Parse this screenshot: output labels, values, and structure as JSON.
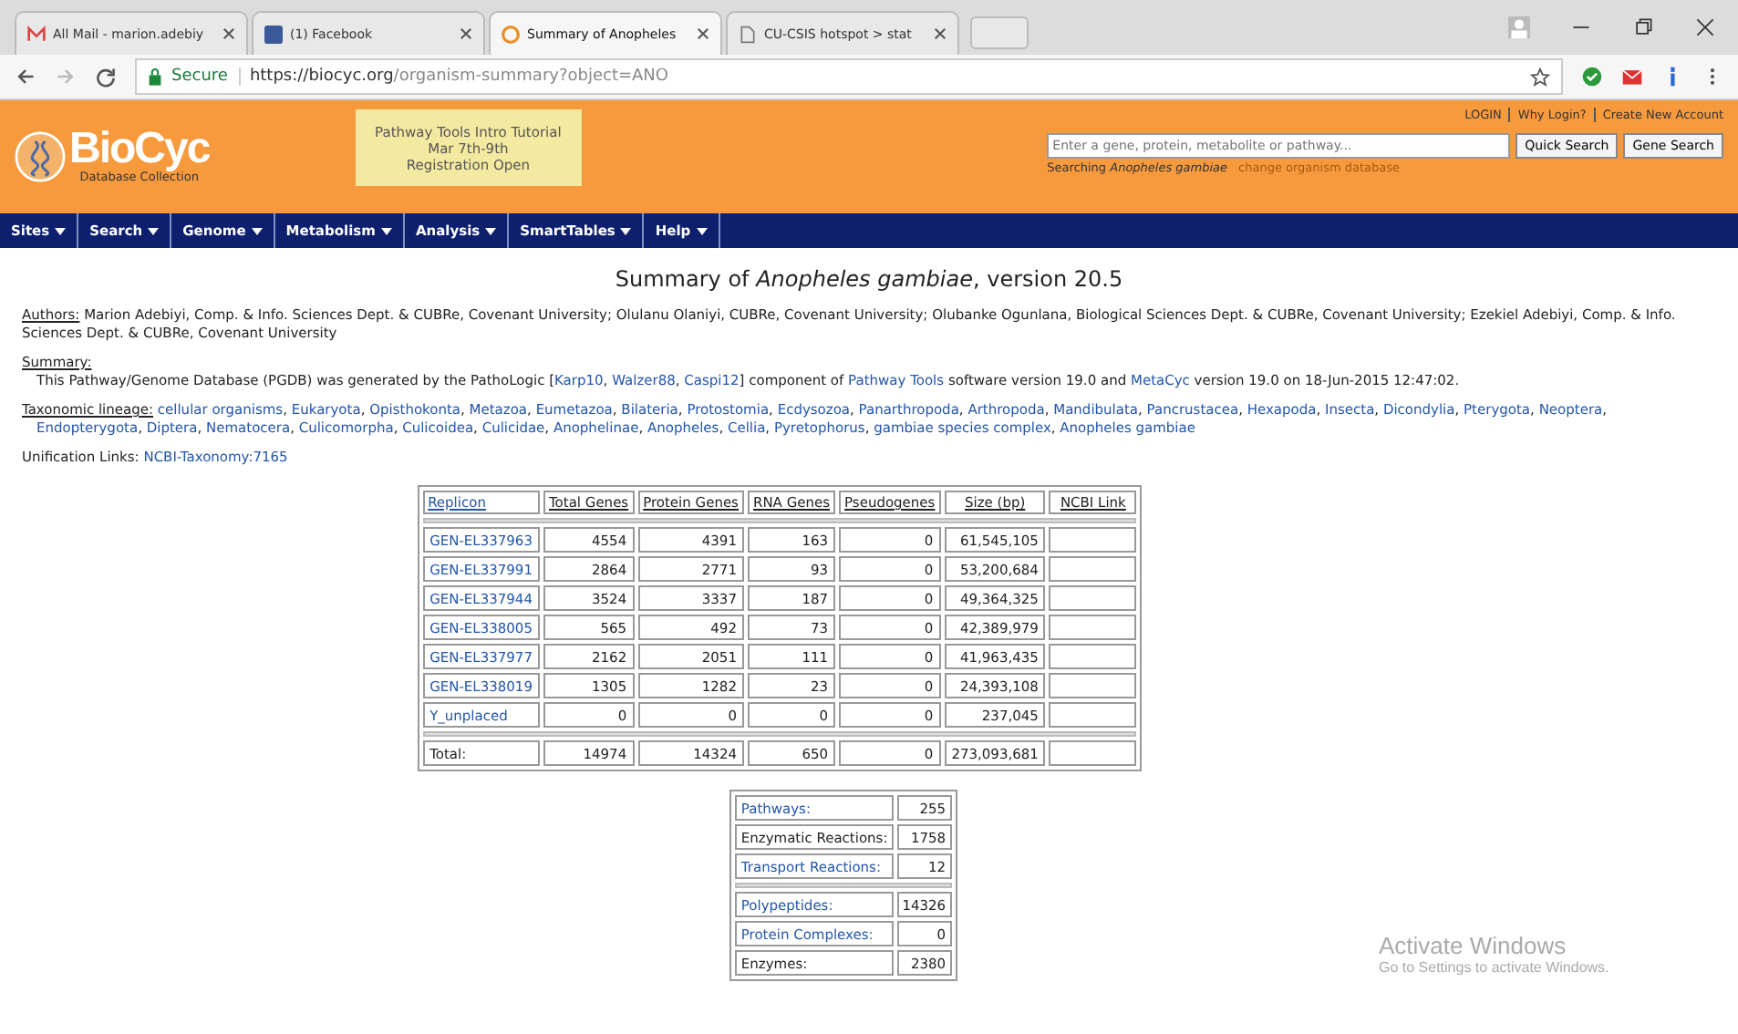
{
  "browser": {
    "tabs": [
      {
        "title": "All Mail - marion.adebiy",
        "kind": "mail",
        "selected": false
      },
      {
        "title": "(1) Facebook",
        "kind": "facebook",
        "selected": false
      },
      {
        "title": "Summary of Anopheles",
        "kind": "loading",
        "selected": true
      },
      {
        "title": "CU-CSIS hotspot > stat",
        "kind": "page",
        "selected": false
      }
    ],
    "secure_label": "Secure",
    "url_host": "https://biocyc.org",
    "url_path": "/organism-summary?object=ANO"
  },
  "header": {
    "logo": "BioCyc",
    "logo_sub": "Database Collection",
    "announcement": [
      "Pathway Tools Intro Tutorial",
      "Mar 7th-9th",
      "Registration Open"
    ],
    "account_links": [
      "LOGIN",
      "Why Login?",
      "Create New Account"
    ],
    "search": {
      "placeholder": "Enter a gene, protein, metabolite or pathway...",
      "buttons": [
        "Quick Search",
        "Gene Search"
      ]
    },
    "searching": "Searching *Anopheles gambiae*",
    "change_link": "change organism database"
  },
  "nav": [
    "Sites",
    "Search",
    "Genome",
    "Metabolism",
    "Analysis",
    "SmartTables",
    "Help"
  ],
  "page": {
    "title": "Summary of *Anopheles gambiae*, version 20.5",
    "authors_label": "Authors:",
    "authors": "Marion Adebiyi, Comp. & Info. Sciences Dept. & CUBRe, Covenant University; Olulanu Olaniyi, CUBRe, Covenant University; Olubanke Ogunlana, Biological Sciences Dept. & CUBRe, Covenant University; Ezekiel Adebiyi, Comp. & Info. Sciences Dept. & CUBRe, Covenant University",
    "summary_label": "Summary:",
    "summary": {
      "before": "This Pathway/Genome Database (PGDB) was generated by the PathoLogic [",
      "references": [
        "Karp10",
        "Walzer88",
        "Caspi12"
      ],
      "reference_separator": ",",
      "middle": "] component of",
      "tool_link": "Pathway Tools",
      "after_tool": "software version 19.0 and",
      "db_link": "MetaCyc",
      "end": "version 19.0 on 18-Jun-2015 12:47:02."
    },
    "lineage_label": "Taxonomic lineage:",
    "lineage_separator": ",",
    "lineage": [
      "cellular organisms",
      "Eukaryota",
      "Opisthokonta",
      "Metazoa",
      "Eumetazoa",
      "Bilateria",
      "Protostomia",
      "Ecdysozoa",
      "Panarthropoda",
      "Arthropoda",
      "Mandibulata",
      "Pancrustacea",
      "Hexapoda",
      "Insecta",
      "Dicondylia",
      "Pterygota",
      "Neoptera",
      "Endopterygota",
      "Diptera",
      "Nematocera",
      "Culicomorpha",
      "Culicoidea",
      "Culicidae",
      "Anophelinae",
      "Anopheles",
      "Cellia",
      "Pyretophorus",
      "gambiae species complex",
      "Anopheles gambiae"
    ],
    "unification_label": "Unification Links:",
    "unification_link": "NCBI-Taxonomy:7165"
  },
  "replicon_table": {
    "columns": [
      "Replicon",
      "Total Genes",
      "Protein Genes",
      "RNA Genes",
      "Pseudogenes",
      "Size (bp)",
      "NCBI Link"
    ],
    "rows": [
      [
        "GEN-EL337963",
        "4554",
        "4391",
        "163",
        "0",
        "61,545,105"
      ],
      [
        "GEN-EL337991",
        "2864",
        "2771",
        "93",
        "0",
        "53,200,684"
      ],
      [
        "GEN-EL337944",
        "3524",
        "3337",
        "187",
        "0",
        "49,364,325"
      ],
      [
        "GEN-EL338005",
        "565",
        "492",
        "73",
        "0",
        "42,389,979"
      ],
      [
        "GEN-EL337977",
        "2162",
        "2051",
        "111",
        "0",
        "41,963,435"
      ],
      [
        "GEN-EL338019",
        "1305",
        "1282",
        "23",
        "0",
        "24,393,108"
      ],
      [
        "Y_unplaced",
        "0",
        "0",
        "0",
        "0",
        "237,045"
      ]
    ],
    "total": [
      "Total:",
      "14974",
      "14324",
      "650",
      "0",
      "273,093,681"
    ]
  },
  "stats_table": [
    [
      {
        "label": "Pathways:",
        "value": "255",
        "link": true
      },
      {
        "label": "Enzymatic Reactions:",
        "value": "1758",
        "link": false
      },
      {
        "label": "Transport Reactions:",
        "value": "12",
        "link": true
      }
    ],
    [
      {
        "label": "Polypeptides:",
        "value": "14326",
        "link": true
      },
      {
        "label": "Protein Complexes:",
        "value": "0",
        "link": true
      },
      {
        "label": "Enzymes:",
        "value": "2380",
        "link": false
      }
    ]
  ],
  "os_notice": {
    "title": "Activate Windows",
    "text": "Go to Settings to activate Windows."
  }
}
